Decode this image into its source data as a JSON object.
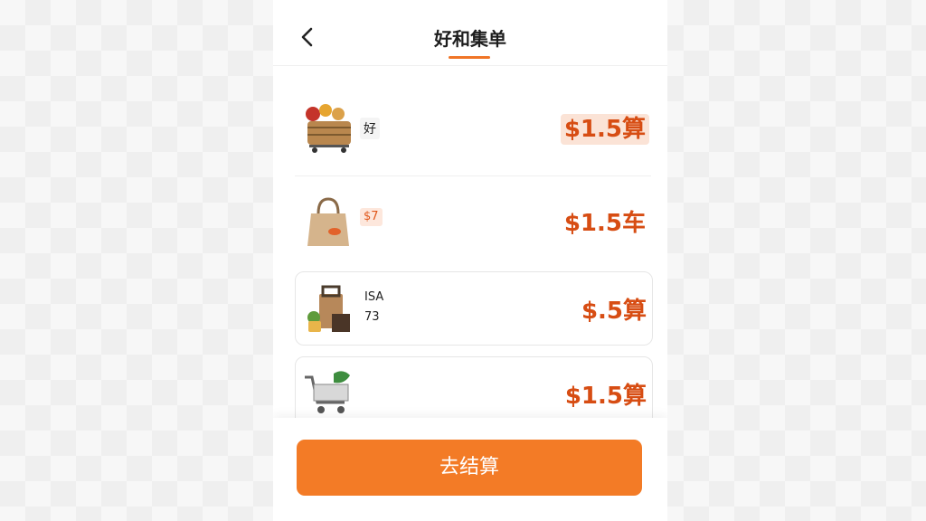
{
  "header": {
    "title": "好和集单",
    "accent": "#f07526"
  },
  "items": [
    {
      "icon": "basket-icon",
      "tag": "好",
      "price": "$1.5算"
    },
    {
      "icon": "bag-icon",
      "tag": "$7",
      "price": "$1.5车"
    },
    {
      "icon": "box-icon",
      "tag_line1": "ISA",
      "tag_line2": "73",
      "price": "$.5算"
    },
    {
      "icon": "cart-icon",
      "price": "$1.5算"
    }
  ],
  "footer": {
    "checkout_label": "去结算",
    "button_color": "#f37b26"
  }
}
